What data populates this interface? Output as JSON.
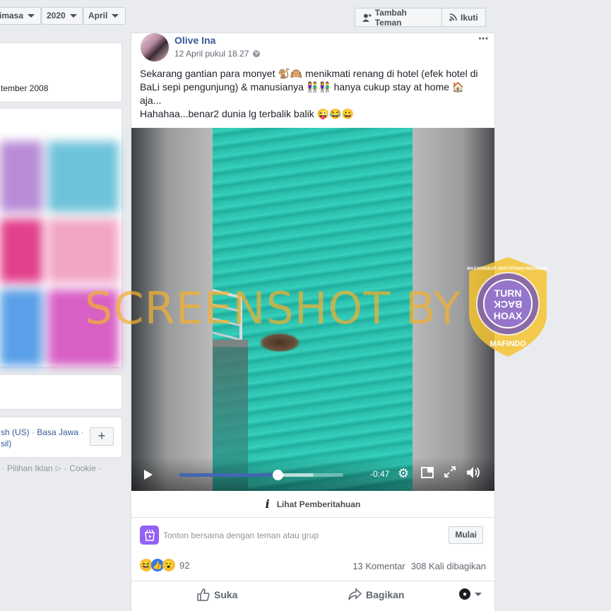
{
  "filters": {
    "period": "imasa",
    "year": "2020",
    "month": "April"
  },
  "profile_actions": {
    "add_friend": "Tambah Teman",
    "follow": "Ikuti"
  },
  "left_column": {
    "joined_text": "tember 2008",
    "languages_line1_a": "sh (US)",
    "languages_line1_sep": "·",
    "languages_line1_b": "Basa Jawa",
    "languages_line1_sep2": "·",
    "languages_line2": "sil)",
    "add_button": "+",
    "footer_sep0": "·",
    "footer_ads": "Pilihan Iklan",
    "footer_sep1": "·",
    "footer_cookie": "Cookie",
    "footer_sep2": "·"
  },
  "post": {
    "author": "Olive Ina",
    "timestamp": "12 April pukul 18.27",
    "more": "•••",
    "text_line1": "Sekarang gantian para monyet 🐒🙉 menikmati renang di hotel (efek hotel di BaLi sepi pengunjung) & manusianya 👫👫 hanya cukup stay at home 🏠 aja...",
    "text_line2": "Hahahaa...benar2 dunia lg terbalik balik 😜😂😀",
    "video": {
      "time_remaining": "-0:47",
      "progress": 0.6,
      "buffered": 0.82
    },
    "notice": "Lihat Pemberitahuan",
    "watch_together": "Tonton bersama dengan teman atau grup",
    "start_button": "Mulai",
    "reaction_count": "92",
    "comments": "13 Komentar",
    "shares": "308 Kali dibagikan",
    "like": "Suka",
    "share": "Bagikan"
  },
  "watermark": {
    "text": "SCREENSHOT BY",
    "badge_top": "TURN",
    "badge_mid": "BACK",
    "badge_bot": "HOAX",
    "badge_ring": "MASYARAKAT ANTI FITNAH INDONESIA",
    "badge_brand": "MAFINDO"
  },
  "colors": {
    "link": "#385898",
    "progress": "#4267b2",
    "water": "#2cc3b0",
    "watermark": "#f2b030"
  }
}
